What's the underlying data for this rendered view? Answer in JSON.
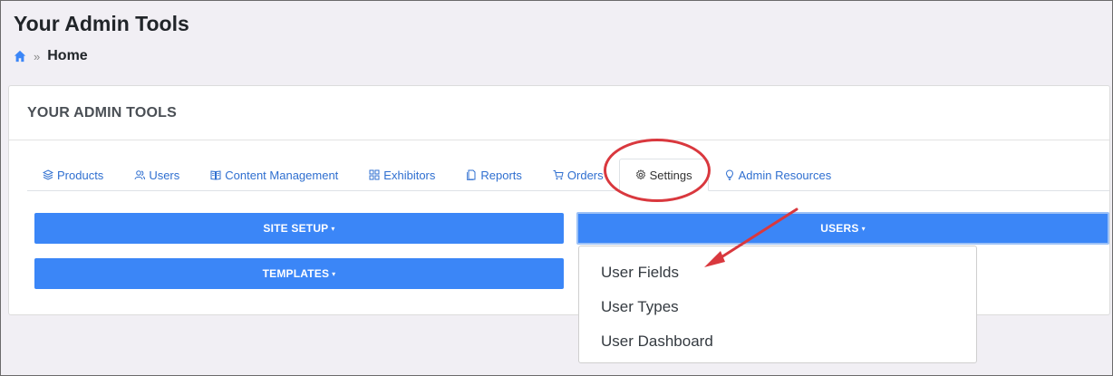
{
  "header": {
    "title": "Your Admin Tools"
  },
  "breadcrumb": {
    "home_label": "Home",
    "separator": "»"
  },
  "card": {
    "title": "YOUR ADMIN TOOLS"
  },
  "tabs": [
    {
      "label": "Products",
      "icon": "layers-icon"
    },
    {
      "label": "Users",
      "icon": "users-icon"
    },
    {
      "label": "Content Management",
      "icon": "book-icon"
    },
    {
      "label": "Exhibitors",
      "icon": "grid-icon"
    },
    {
      "label": "Reports",
      "icon": "document-icon"
    },
    {
      "label": "Orders",
      "icon": "cart-icon"
    },
    {
      "label": "Settings",
      "icon": "gear-icon",
      "active": true
    },
    {
      "label": "Admin Resources",
      "icon": "lightbulb-icon"
    }
  ],
  "buttons": {
    "site_setup": "SITE SETUP",
    "templates": "TEMPLATES",
    "users": "USERS",
    "caret": "▾"
  },
  "dropdown": {
    "items": [
      "User Fields",
      "User Types",
      "User Dashboard"
    ]
  },
  "colors": {
    "accent": "#3b86f7",
    "annotation": "#d9383e",
    "tab_link": "#2f6fd0"
  }
}
